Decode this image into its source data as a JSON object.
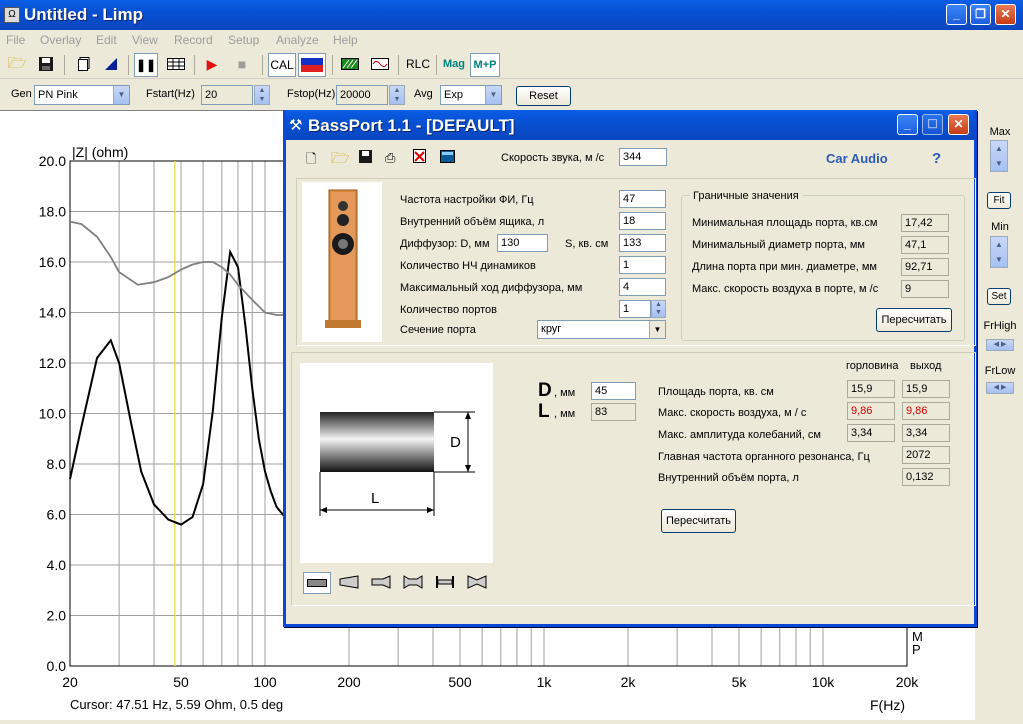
{
  "window": {
    "title": "Untitled - Limp",
    "icon": "app-icon"
  },
  "menu": [
    "File",
    "Overlay",
    "Edit",
    "View",
    "Record",
    "Setup",
    "Analyze",
    "Help"
  ],
  "toolbar": {
    "cal": "CAL",
    "rlc": "RLC",
    "mag": "Mag",
    "mp": "M+P"
  },
  "gen": {
    "label": "Gen",
    "value": "PN Pink",
    "fstart_label": "Fstart(Hz)",
    "fstart": "20",
    "fstop_label": "Fstop(Hz)",
    "fstop": "20000",
    "avg_label": "Avg",
    "avg": "Exp",
    "reset": "Reset"
  },
  "right_panel": {
    "max": "Max",
    "fit": "Fit",
    "min": "Min",
    "set": "Set",
    "frhigh": "FrHigh",
    "frlow": "FrLow"
  },
  "chart_data": {
    "type": "line",
    "ylabel": "|Z| (ohm)",
    "xlabel": "F(Hz)",
    "x_scale": "log",
    "xlim": [
      20,
      20000
    ],
    "ylim": [
      0,
      20
    ],
    "x_ticks": [
      "20",
      "50",
      "100",
      "200",
      "500",
      "1k",
      "2k",
      "5k",
      "10k",
      "20k"
    ],
    "y_ticks": [
      "20.0",
      "18.0",
      "16.0",
      "14.0",
      "12.0",
      "10.0",
      "8.0",
      "6.0",
      "4.0",
      "2.0",
      "0.0"
    ],
    "grid": true,
    "right_labels": [
      "M",
      "P"
    ],
    "cursor_line_x": 47.51,
    "series": [
      {
        "color": "#000000",
        "x": [
          20,
          22,
          25,
          28,
          30,
          33,
          36,
          40,
          45,
          50,
          55,
          60,
          65,
          70,
          75,
          80,
          85,
          90,
          95,
          100,
          105,
          110,
          120
        ],
        "y": [
          7.4,
          9.5,
          12.2,
          12.9,
          12.0,
          9.7,
          7.7,
          6.4,
          5.8,
          5.6,
          5.9,
          7.2,
          10.1,
          13.8,
          16.4,
          15.8,
          13.5,
          11.0,
          9.0,
          7.7,
          6.9,
          6.3,
          5.8
        ]
      },
      {
        "color": "#808080",
        "x": [
          20,
          22,
          25,
          28,
          30,
          35,
          40,
          45,
          50,
          55,
          60,
          65,
          70,
          75,
          80,
          90,
          100,
          110,
          120
        ],
        "y": [
          17.6,
          17.5,
          17.0,
          16.2,
          15.6,
          15.1,
          15.2,
          15.4,
          15.7,
          15.9,
          16.0,
          16.0,
          15.8,
          15.5,
          15.1,
          14.5,
          14.0,
          13.9,
          13.9
        ]
      }
    ]
  },
  "cursor": "Cursor: 47.51 Hz, 5.59 Ohm, 0.5 deg",
  "bassport": {
    "title": "BassPort 1.1 - [DEFAULT]",
    "sound_speed_label": "Скорость звука, м /с",
    "sound_speed": "344",
    "brand": "Car Audio",
    "help": "?",
    "params": {
      "fb_label": "Частота настройки ФИ, Гц",
      "fb": "47",
      "vol_label": "Внутренний объём ящика, л",
      "vol": "18",
      "diff_label": "Диффузор: D, мм",
      "diff_d": "130",
      "s_label": "S, кв. см",
      "diff_s": "133",
      "count_label": "Количество НЧ динамиков",
      "count": "1",
      "xmax_label": "Максимальный ход диффузора, мм",
      "xmax": "4",
      "ports_label": "Количество портов",
      "ports": "1",
      "section_label": "Сечение порта",
      "section": "круг"
    },
    "limits": {
      "title": "Граничные значения",
      "rows": [
        {
          "label": "Минимальная площадь порта, кв.см",
          "value": "17,42"
        },
        {
          "label": "Минимальный диаметр порта, мм",
          "value": "47,1"
        },
        {
          "label": "Длина порта при мин. диаметре, мм",
          "value": "92,71"
        },
        {
          "label": "Макс. скорость воздуха в порте, м /с",
          "value": "9"
        }
      ],
      "recalc": "Пересчитать"
    },
    "port": {
      "d_letter": "D",
      "l_letter": "L",
      "mm": ", мм",
      "d": "45",
      "l": "83",
      "diagram_d": "D",
      "diagram_l": "L",
      "col_throat": "горловина",
      "col_exit": "выход",
      "rows": [
        {
          "label": "Площадь порта, кв. см",
          "throat": "15,9",
          "exit": "15,9"
        },
        {
          "label": "Макс. скорость воздуха, м / с",
          "throat": "9,86",
          "exit": "9,86"
        },
        {
          "label": "Макс. амплитуда колебаний, см",
          "throat": "3,34",
          "exit": "3,34"
        },
        {
          "label": "Главная частота органного резонанса, Гц",
          "value": "2072"
        },
        {
          "label": "Внутренний объём порта, л",
          "value": "0,132"
        }
      ],
      "recalc": "Пересчитать"
    }
  }
}
